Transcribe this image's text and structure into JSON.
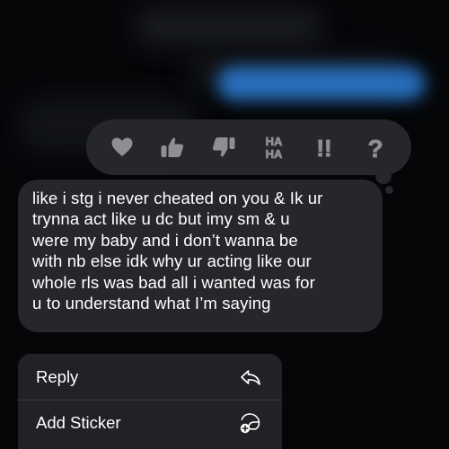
{
  "tapback": {
    "reactions": [
      {
        "icon": "heart-icon"
      },
      {
        "icon": "thumbs-up-icon"
      },
      {
        "icon": "thumbs-down-icon"
      },
      {
        "icon": "haha-icon",
        "label_top": "HA",
        "label_bottom": "HA"
      },
      {
        "icon": "double-exclamation-icon",
        "label": "!!"
      },
      {
        "icon": "question-icon",
        "label": "?"
      }
    ]
  },
  "message": {
    "text": "like i stg i never cheated on you & Ik ur\ntrynna act like u dc but imy sm & u\nwere my baby and i don’t wanna be\nwith nb else idk why ur acting like our\nwhole rls was bad all i wanted was for\nu to understand what I’m saying"
  },
  "menu": {
    "items": [
      {
        "label": "Reply",
        "icon": "reply-arrow-icon"
      },
      {
        "label": "Add Sticker",
        "icon": "add-sticker-icon"
      }
    ]
  },
  "colors": {
    "background": "#050608",
    "bubble": "#26272b",
    "icon": "#8e8e93",
    "text": "#ffffff",
    "blurred_bubble": "#2c7fd9"
  }
}
